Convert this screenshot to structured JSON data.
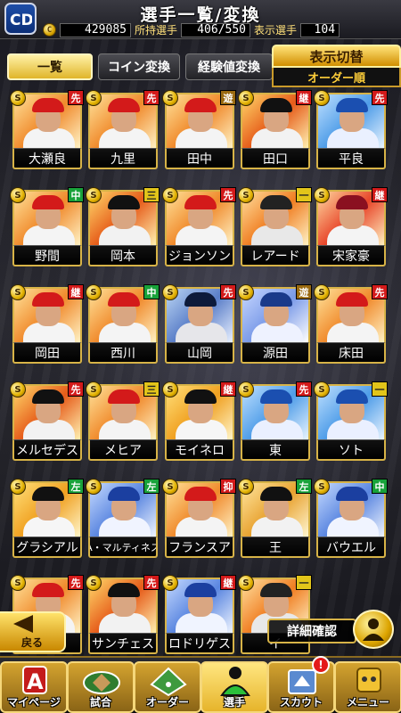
{
  "header": {
    "title": "選手一覧/変換",
    "coins": "429085",
    "owned_label": "所持選手",
    "owned_value": "406/550",
    "shown_label": "表示選手",
    "shown_value": "104"
  },
  "tabs": [
    {
      "label": "一覧",
      "active": true
    },
    {
      "label": "コイン変換",
      "active": false
    },
    {
      "label": "経験値変換",
      "active": false
    }
  ],
  "display_switch": {
    "label": "表示切替",
    "value": "オーダー順"
  },
  "players": [
    {
      "name": "大瀬良",
      "pos": "先",
      "team": "carp"
    },
    {
      "name": "九里",
      "pos": "先",
      "team": "carp"
    },
    {
      "name": "田中",
      "pos": "遊",
      "team": "carp"
    },
    {
      "name": "田口",
      "pos": "継",
      "team": "giants"
    },
    {
      "name": "平良",
      "pos": "先",
      "team": "baystars"
    },
    {
      "name": "野間",
      "pos": "中",
      "team": "carp"
    },
    {
      "name": "岡本",
      "pos": "三",
      "team": "giants"
    },
    {
      "name": "ジョンソン",
      "pos": "先",
      "team": "carp"
    },
    {
      "name": "レアード",
      "pos": "一",
      "team": "marines"
    },
    {
      "name": "宋家豪",
      "pos": "継",
      "team": "eagles"
    },
    {
      "name": "岡田",
      "pos": "継",
      "team": "carp"
    },
    {
      "name": "西川",
      "pos": "中",
      "team": "carp"
    },
    {
      "name": "山岡",
      "pos": "先",
      "team": "buffaloes"
    },
    {
      "name": "源田",
      "pos": "遊",
      "team": "lions"
    },
    {
      "name": "床田",
      "pos": "先",
      "team": "carp"
    },
    {
      "name": "メルセデス",
      "pos": "先",
      "team": "giants"
    },
    {
      "name": "メヒア",
      "pos": "三",
      "team": "carp"
    },
    {
      "name": "モイネロ",
      "pos": "継",
      "team": "hawks"
    },
    {
      "name": "東",
      "pos": "先",
      "team": "baystars"
    },
    {
      "name": "ソト",
      "pos": "一",
      "team": "baystars"
    },
    {
      "name": "グラシアル",
      "pos": "左",
      "team": "hawks"
    },
    {
      "name": "A・マルティネス",
      "pos": "左",
      "team": "dragons"
    },
    {
      "name": "フランスア",
      "pos": "抑",
      "team": "carp"
    },
    {
      "name": "王",
      "pos": "左",
      "team": "fighters"
    },
    {
      "name": "バウエル",
      "pos": "中",
      "team": "dragons"
    },
    {
      "name": "",
      "pos": "先",
      "team": "carp"
    },
    {
      "name": "サンチェス",
      "pos": "先",
      "team": "giants"
    },
    {
      "name": "ロドリゲス",
      "pos": "継",
      "team": "dragons"
    },
    {
      "name": "イ",
      "pos": "一",
      "team": "marines"
    }
  ],
  "buttons": {
    "back": "戻る",
    "detail": "詳細確認"
  },
  "nav": [
    {
      "label": "マイページ",
      "icon": "mypage-icon"
    },
    {
      "label": "試合",
      "icon": "stadium-icon"
    },
    {
      "label": "オーダー",
      "icon": "field-icon"
    },
    {
      "label": "選手",
      "icon": "player-icon",
      "active": true
    },
    {
      "label": "スカウト",
      "icon": "scout-icon",
      "badge": "!"
    },
    {
      "label": "メニュー",
      "icon": "menu-icon"
    }
  ],
  "colors": {
    "gold": "#d7b347",
    "pos_pitcher": "#d31a1a",
    "pos_infield": "#e2c51a",
    "pos_outfield": "#18a23a",
    "pos_short": "#9a6a10"
  }
}
